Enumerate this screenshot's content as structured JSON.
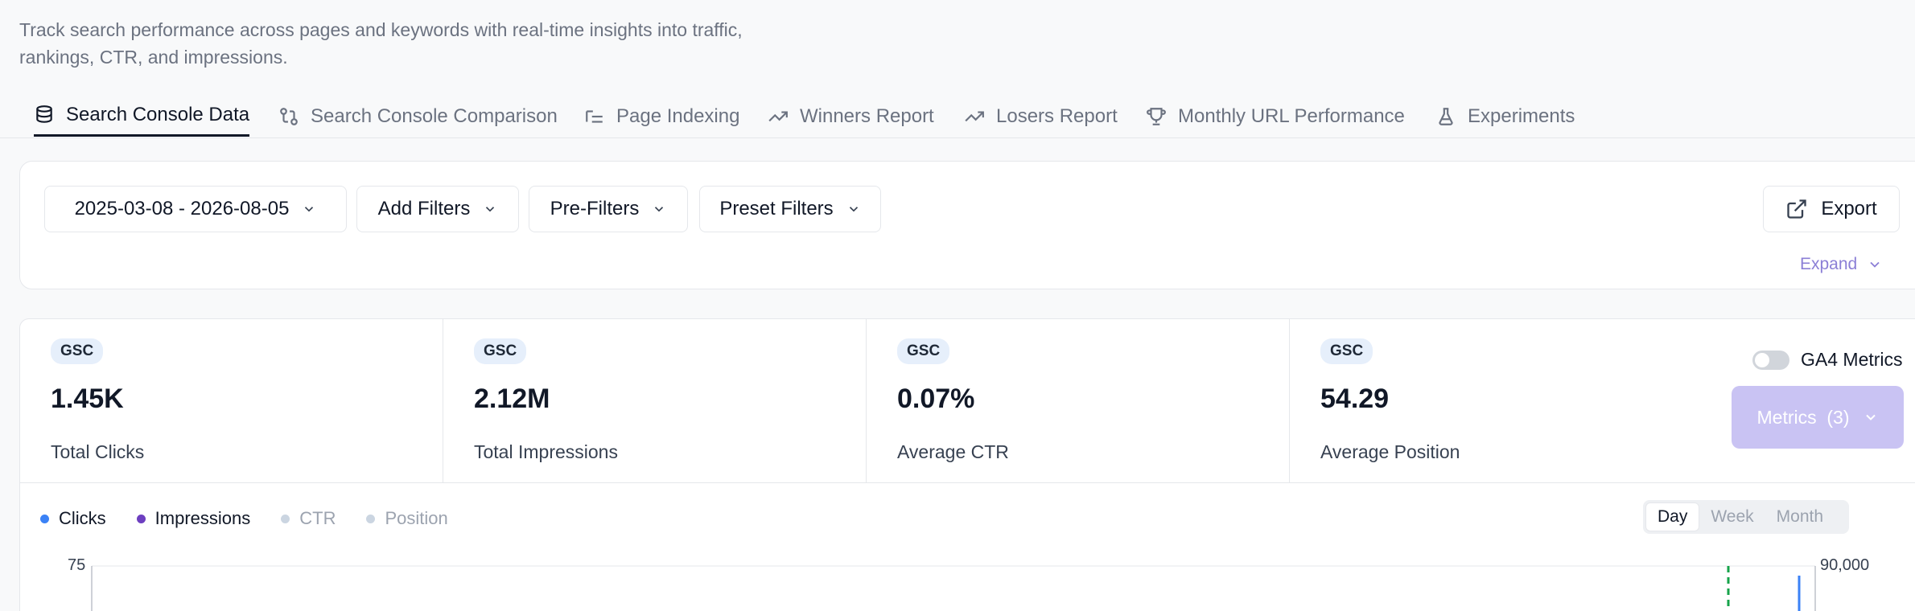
{
  "description": "Track search performance across pages and keywords with real-time insights into traffic, rankings, CTR, and impressions.",
  "tabs": [
    {
      "label": "Search Console Data",
      "icon": "database-icon",
      "active": true
    },
    {
      "label": "Search Console Comparison",
      "icon": "git-compare-icon",
      "active": false
    },
    {
      "label": "Page Indexing",
      "icon": "list-indent-icon",
      "active": false
    },
    {
      "label": "Winners Report",
      "icon": "trending-up-icon",
      "active": false
    },
    {
      "label": "Losers Report",
      "icon": "trending-up-icon",
      "active": false
    },
    {
      "label": "Monthly URL Performance",
      "icon": "trophy-icon",
      "active": false
    },
    {
      "label": "Experiments",
      "icon": "flask-icon",
      "active": false
    }
  ],
  "filters": {
    "date_range": "2025-03-08 - 2026-08-05",
    "add_filters": "Add Filters",
    "pre_filters": "Pre-Filters",
    "preset_filters": "Preset Filters",
    "export": "Export",
    "expand": "Expand"
  },
  "metrics": [
    {
      "badge": "GSC",
      "value": "1.45K",
      "label": "Total Clicks"
    },
    {
      "badge": "GSC",
      "value": "2.12M",
      "label": "Total Impressions"
    },
    {
      "badge": "GSC",
      "value": "0.07%",
      "label": "Average CTR"
    },
    {
      "badge": "GSC",
      "value": "54.29",
      "label": "Average Position"
    }
  ],
  "ga4_toggle": {
    "label": "GA4 Metrics",
    "enabled": false
  },
  "metrics_dropdown": "Metrics  (3)",
  "legend": [
    {
      "label": "Clicks",
      "color": "#3b82f6",
      "active": true
    },
    {
      "label": "Impressions",
      "color": "#6d3fc0",
      "active": true
    },
    {
      "label": "CTR",
      "color": "#cbd5e1",
      "active": false
    },
    {
      "label": "Position",
      "color": "#cbd5e1",
      "active": false
    }
  ],
  "period": {
    "day": "Day",
    "week": "Week",
    "month": "Month",
    "selected": "Day"
  },
  "chart_data": {
    "type": "line",
    "y_left_top_tick": "75",
    "y_right_top_tick": "90,000"
  },
  "colors": {
    "accent": "#c9c3f3",
    "expand": "#8b7fd6",
    "clicks": "#3b82f6",
    "marker": "#16a34a"
  }
}
